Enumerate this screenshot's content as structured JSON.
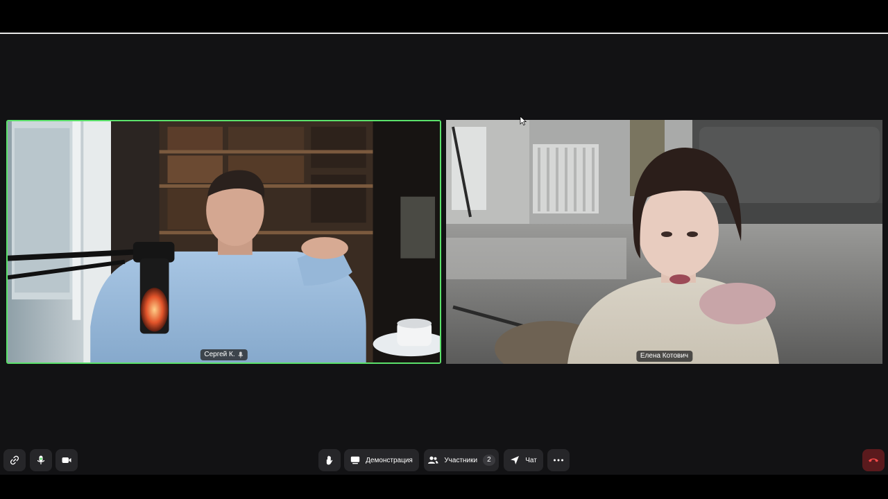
{
  "participants": [
    {
      "name": "Сергей К.",
      "speaking": true,
      "mic_icon": "mic-icon"
    },
    {
      "name": "Елена Котович",
      "speaking": false
    }
  ],
  "toolbar": {
    "link_icon": "link-icon",
    "mic_icon": "mic-icon",
    "camera_icon": "camera-icon",
    "raise_hand_icon": "hand-icon",
    "demo_label": "Демонстрация",
    "participants_label": "Участники",
    "participants_count": "2",
    "chat_label": "Чат",
    "more_icon": "more-icon",
    "hangup_icon": "hangup-icon"
  },
  "colors": {
    "active_speaker_border": "#5be26b",
    "background": "#121214",
    "button": "#262629",
    "hangup": "#5a1a1d"
  }
}
